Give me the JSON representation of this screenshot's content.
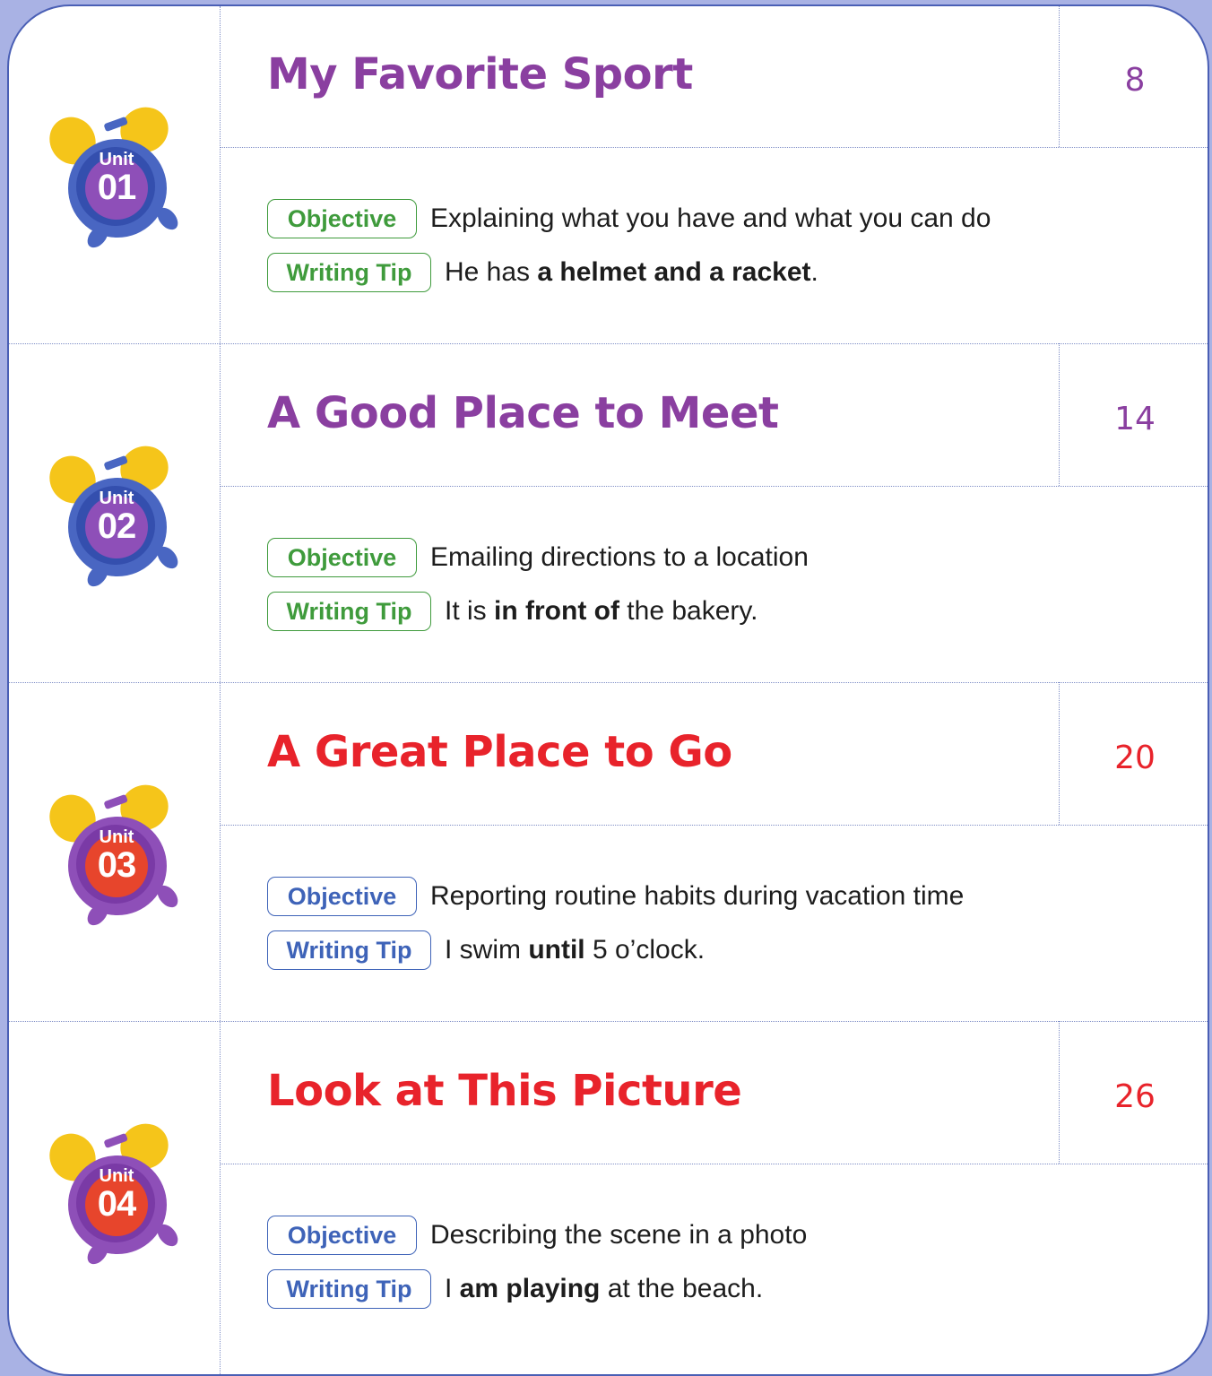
{
  "colors": {
    "purple_title": "#8a3fa0",
    "red_title": "#e8232b",
    "green_tag": "#3f9b3c",
    "blue_tag": "#3e63b8",
    "clock_blue": "#4966c2",
    "clock_purple": "#8e4fb8",
    "clock_red": "#e7452c",
    "bell_yellow": "#f5c51a"
  },
  "units": [
    {
      "unit_label": "Unit",
      "number": "01",
      "title": "My Favorite Sport",
      "page": "8",
      "objective_label": "Objective",
      "objective": "Explaining what you have and what you can do",
      "tip_label": "Writing Tip",
      "tip_pre": "He has ",
      "tip_bold": "a helmet and a racket",
      "tip_post": "."
    },
    {
      "unit_label": "Unit",
      "number": "02",
      "title": "A Good Place to Meet",
      "page": "14",
      "objective_label": "Objective",
      "objective": "Emailing directions to a location",
      "tip_label": "Writing Tip",
      "tip_pre": "It is ",
      "tip_bold": "in front of",
      "tip_post": " the bakery."
    },
    {
      "unit_label": "Unit",
      "number": "03",
      "title": "A Great Place to Go",
      "page": "20",
      "objective_label": "Objective",
      "objective": "Reporting routine habits during vacation time",
      "tip_label": "Writing Tip",
      "tip_pre": "I swim ",
      "tip_bold": "until",
      "tip_post": " 5 o’clock."
    },
    {
      "unit_label": "Unit",
      "number": "04",
      "title": "Look at This Picture",
      "page": "26",
      "objective_label": "Objective",
      "objective": "Describing the scene in a photo",
      "tip_label": "Writing Tip",
      "tip_pre": "I ",
      "tip_bold": "am playing",
      "tip_post": " at the beach."
    }
  ]
}
